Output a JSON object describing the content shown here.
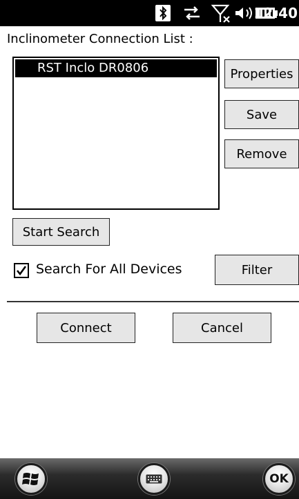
{
  "status_bar": {
    "time": "12:40",
    "icons": [
      "bluetooth-icon",
      "data-sync-icon",
      "no-signal-icon",
      "volume-icon",
      "battery-icon"
    ]
  },
  "dialog": {
    "title": "Inclinometer Connection List :",
    "devices": [
      "RST Inclo DR0806"
    ],
    "buttons": {
      "properties": "Properties",
      "save": "Save",
      "remove": "Remove",
      "start_search": "Start Search",
      "filter": "Filter",
      "connect": "Connect",
      "cancel": "Cancel"
    },
    "search_all": {
      "label": "Search For All Devices",
      "checked": true
    }
  },
  "bottom_bar": {
    "start": "windows-start-icon",
    "keyboard": "keyboard-icon",
    "ok_label": "OK"
  }
}
